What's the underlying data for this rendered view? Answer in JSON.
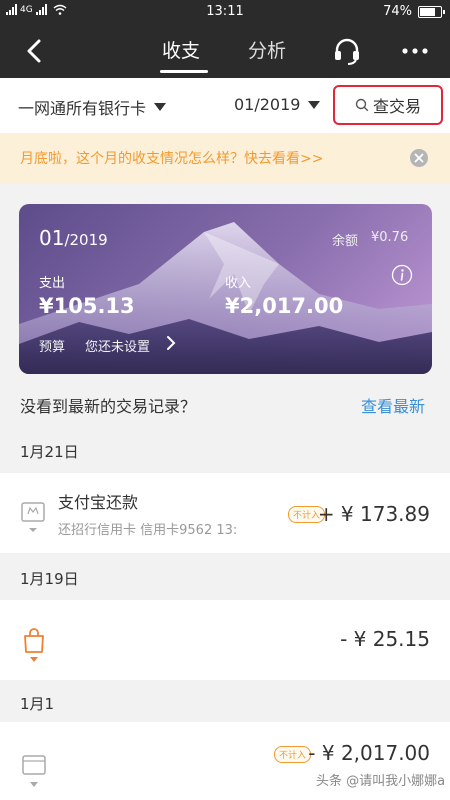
{
  "status_bar": {
    "network_left": "4G",
    "time": "13:11",
    "battery_percent": "74%",
    "battery_level": 0.74
  },
  "nav": {
    "tabs": [
      {
        "label": "收支",
        "active": true
      },
      {
        "label": "分析",
        "active": false
      }
    ],
    "icons": [
      "back-icon",
      "headset-icon",
      "more-icon"
    ]
  },
  "filter": {
    "card": "一网通所有银行卡",
    "month": "01/2019",
    "search_label": "查交易"
  },
  "notice": {
    "text": "月底啦，这个月的收支情况怎么样？快去看看>>"
  },
  "summary": {
    "month": "01",
    "year": "/2019",
    "balance_label": "余额",
    "balance": "¥0.76",
    "expense_label": "支出",
    "expense": "¥105.13",
    "income_label": "收入",
    "income": "¥2,017.00",
    "budget_label": "预算",
    "budget_value": "您还未设置"
  },
  "latest": {
    "text": "没看到最新的交易记录？",
    "link": "查看最新"
  },
  "groups": [
    {
      "date": "1月21日",
      "items": [
        {
          "title": "支付宝还款",
          "subtitle": "还招行信用卡  信用卡9562 13:",
          "badge": "不计入",
          "amount": "+ ¥ 173.89",
          "icon": "card-icon"
        }
      ]
    },
    {
      "date": "1月19日",
      "items": [
        {
          "title": "",
          "subtitle": "",
          "badge": "",
          "amount": "- ¥ 25.15",
          "icon": "shopping-bag-icon"
        }
      ]
    },
    {
      "date": "1月1",
      "items": [
        {
          "title": "",
          "subtitle": "",
          "badge": "不计入",
          "amount": "- ¥ 2,017.00",
          "icon": "transfer-icon"
        }
      ]
    }
  ],
  "watermark": "头条 @请叫我小娜娜a",
  "colors": {
    "nav_bg": "#2b2b2b",
    "accent_orange": "#f39a2e",
    "link_blue": "#3a8fd6",
    "highlight_red": "#e0283a",
    "notice_bg": "#fdf0d9"
  }
}
